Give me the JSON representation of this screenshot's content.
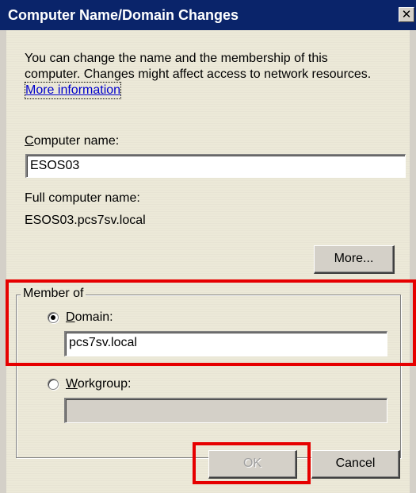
{
  "window": {
    "title": "Computer Name/Domain Changes",
    "close_glyph": "✕"
  },
  "intro": {
    "line1": "You can change the name and the membership of this",
    "line2": "computer. Changes might affect access to network resources.",
    "more_info_link": "More information"
  },
  "computer_name": {
    "label": "Computer name:",
    "value": "ESOS03"
  },
  "full_name": {
    "label": "Full computer name:",
    "value": "ESOS03.pcs7sv.local"
  },
  "more_button": "More...",
  "member_of": {
    "legend": "Member of",
    "domain": {
      "label": "Domain:",
      "selected": true,
      "value": "pcs7sv.local"
    },
    "workgroup": {
      "label": "Workgroup:",
      "selected": false,
      "value": ""
    }
  },
  "buttons": {
    "ok": "OK",
    "cancel": "Cancel"
  },
  "colors": {
    "titlebar": "#0a246a",
    "highlight": "#e60000",
    "link": "#0000cc"
  },
  "icons": {
    "close": "close-icon",
    "radio_selected": "radio-selected-icon",
    "radio_unselected": "radio-unselected-icon"
  }
}
